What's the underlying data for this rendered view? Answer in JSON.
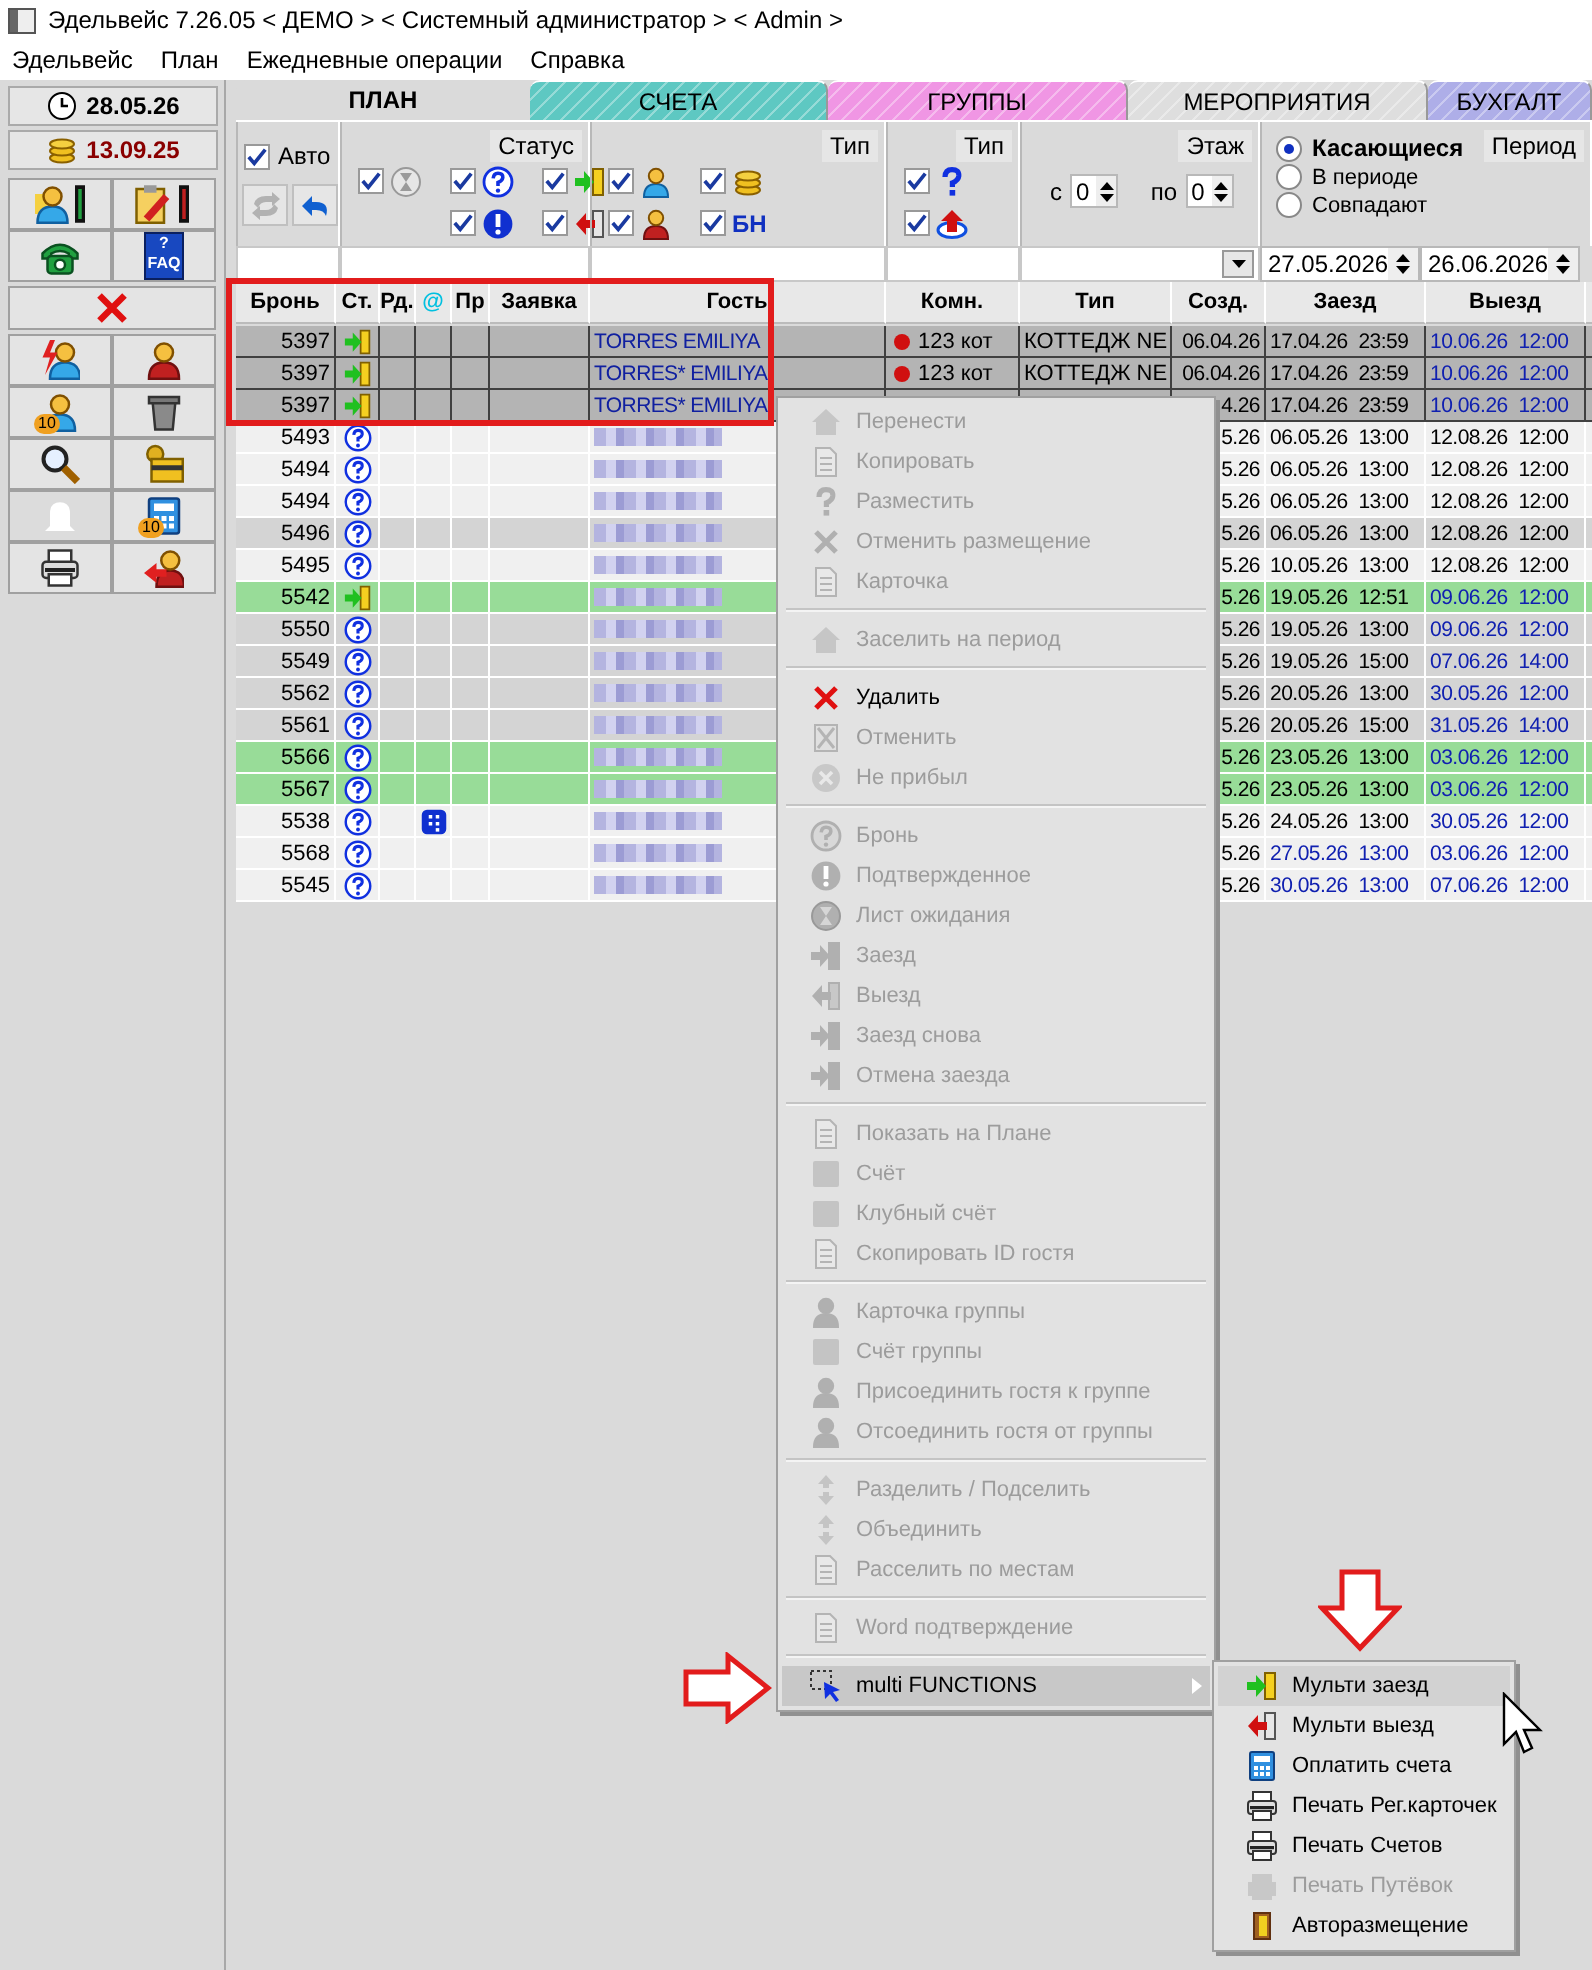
{
  "window": {
    "title": "Эдельвейс 7.26.05 < ДЕМО > < Системный администратор > < Admin >"
  },
  "menu_bar": [
    "Эдельвейс",
    "План",
    "Ежедневные операции",
    "Справка"
  ],
  "sidebar": {
    "dates": [
      "28.05.26",
      "13.09.25"
    ],
    "buttons": [
      {
        "kind": "person_meter",
        "wide": false,
        "disabled": false
      },
      {
        "kind": "clipboard_meter",
        "wide": false,
        "disabled": false
      },
      {
        "kind": "phone",
        "wide": false,
        "disabled": false
      },
      {
        "kind": "faq",
        "label": "?\nFAQ",
        "wide": false,
        "disabled": false
      },
      {
        "kind": "cross",
        "wide": true,
        "disabled": false
      },
      {
        "kind": "person_flash",
        "wide": false,
        "disabled": false
      },
      {
        "kind": "person_red",
        "wide": false,
        "disabled": false
      },
      {
        "kind": "person",
        "badge": "10",
        "wide": false,
        "disabled": false
      },
      {
        "kind": "trash",
        "wide": false,
        "disabled": false
      },
      {
        "kind": "magnifier",
        "wide": false,
        "disabled": false
      },
      {
        "kind": "keycard",
        "wide": false,
        "disabled": false
      },
      {
        "kind": "bell",
        "wide": false,
        "disabled": true
      },
      {
        "kind": "calc",
        "badge": "10",
        "wide": false,
        "disabled": false
      },
      {
        "kind": "printer",
        "wide": false,
        "disabled": false
      },
      {
        "kind": "person_arrow",
        "wide": false,
        "disabled": false
      }
    ]
  },
  "tabs": [
    {
      "label": "ПЛАН",
      "selected": true,
      "color": "#dadada"
    },
    {
      "label": "СЧЕТА",
      "selected": false,
      "color": "#5ec8c2"
    },
    {
      "label": "ГРУППЫ",
      "selected": false,
      "color": "#f096e4"
    },
    {
      "label": "МЕРОПРИЯТИЯ",
      "selected": false,
      "color": "#dedede"
    },
    {
      "label": "БУХГАЛТ",
      "selected": false,
      "color": "#aeaee8"
    }
  ],
  "filters": {
    "auto": {
      "label": "Авто",
      "checked": true
    },
    "tools": [
      {
        "kind": "refresh",
        "disabled": true
      },
      {
        "kind": "undo",
        "disabled": false
      }
    ],
    "groups": [
      {
        "label": "Статус",
        "columns": [
          [
            {
              "kind": "hourglass",
              "checked": true
            }
          ],
          [
            {
              "kind": "question",
              "checked": true
            },
            {
              "kind": "exclamation",
              "checked": true
            }
          ],
          [
            {
              "kind": "checkin",
              "checked": true
            },
            {
              "kind": "checkout",
              "checked": true
            }
          ]
        ]
      },
      {
        "label": "Тип",
        "columns": [
          [
            {
              "kind": "person",
              "checked": true
            },
            {
              "kind": "person_red",
              "checked": true
            }
          ],
          [
            {
              "kind": "coins",
              "checked": true
            },
            {
              "kind": "text",
              "text": "БН",
              "checked": true
            }
          ]
        ]
      },
      {
        "label": "Тип",
        "columns": [
          [
            {
              "kind": "question_bold",
              "checked": true
            },
            {
              "kind": "upload",
              "checked": true
            }
          ]
        ]
      }
    ],
    "floor": {
      "label": "Этаж",
      "from_label": "с",
      "from": "0",
      "to_label": "по",
      "to": "0"
    },
    "period": {
      "label": "Период",
      "options": [
        {
          "label": "Касающиеся",
          "selected": true
        },
        {
          "label": "В периоде",
          "selected": false
        },
        {
          "label": "Совпадают",
          "selected": false
        }
      ]
    },
    "date_from": "27.05.2026",
    "date_to": "26.06.2026"
  },
  "table": {
    "columns": [
      "Бронь",
      "Ст.",
      "Рд.",
      "@",
      "Пр",
      "Заявка",
      "Гость",
      "Комн.",
      "Тип",
      "Созд.",
      "Заезд",
      "Выезд"
    ],
    "rows": [
      {
        "id": "5397",
        "kind": "checkin",
        "selected": true,
        "color": "#b4b4b4",
        "web": false,
        "guest": "TORRES EMILIYA",
        "guest_blurred": false,
        "room": {
          "text": "123 кот",
          "color": "#d01010"
        },
        "type": "КОТТЕДЖ NE",
        "created": "06.04.26",
        "arrival": "17.04.26  23:59",
        "arrival_marked": false,
        "departure": "10.06.26  12:00",
        "departure_marked": true
      },
      {
        "id": "5397",
        "kind": "checkin",
        "selected": true,
        "color": "#b4b4b4",
        "web": false,
        "guest": "TORRES* EMILIYA",
        "guest_blurred": false,
        "room": {
          "text": "123 кот",
          "color": "#d01010"
        },
        "type": "КОТТЕДЖ NE",
        "created": "06.04.26",
        "arrival": "17.04.26  23:59",
        "arrival_marked": false,
        "departure": "10.06.26  12:00",
        "departure_marked": true
      },
      {
        "id": "5397",
        "kind": "checkin",
        "selected": true,
        "color": "#b4b4b4",
        "web": false,
        "guest": "TORRES* EMILIYA",
        "guest_blurred": false,
        "created": "4.26",
        "arrival": "17.04.26  23:59",
        "arrival_marked": false,
        "departure": "10.06.26  12:00",
        "departure_marked": true
      },
      {
        "id": "5493",
        "kind": "booking",
        "selected": false,
        "color": "#f0f0f0",
        "web": false,
        "guest_blurred": true,
        "created": "5.26",
        "arrival": "06.05.26  13:00",
        "arrival_marked": false,
        "departure": "12.08.26  12:00",
        "departure_marked": false
      },
      {
        "id": "5494",
        "kind": "booking",
        "selected": false,
        "color": "#f0f0f0",
        "web": false,
        "guest_blurred": true,
        "created": "5.26",
        "arrival": "06.05.26  13:00",
        "arrival_marked": false,
        "departure": "12.08.26  12:00",
        "departure_marked": false
      },
      {
        "id": "5494",
        "kind": "booking",
        "selected": false,
        "color": "#f0f0f0",
        "web": false,
        "guest_blurred": true,
        "created": "5.26",
        "arrival": "06.05.26  13:00",
        "arrival_marked": false,
        "departure": "12.08.26  12:00",
        "departure_marked": false
      },
      {
        "id": "5496",
        "kind": "booking",
        "selected": false,
        "color": "#d4d4d4",
        "web": false,
        "guest_blurred": true,
        "created": "5.26",
        "arrival": "06.05.26  13:00",
        "arrival_marked": false,
        "departure": "12.08.26  12:00",
        "departure_marked": false
      },
      {
        "id": "5495",
        "kind": "booking",
        "selected": false,
        "color": "#f0f0f0",
        "web": false,
        "guest_blurred": true,
        "created": "5.26",
        "arrival": "10.05.26  13:00",
        "arrival_marked": false,
        "departure": "12.08.26  12:00",
        "departure_marked": false
      },
      {
        "id": "5542",
        "kind": "checkin",
        "selected": false,
        "color": "#98dc98",
        "web": false,
        "guest_blurred": true,
        "created": "5.26",
        "arrival": "19.05.26  12:51",
        "arrival_marked": false,
        "departure": "09.06.26  12:00",
        "departure_marked": true
      },
      {
        "id": "5550",
        "kind": "booking",
        "selected": false,
        "color": "#d4d4d4",
        "web": false,
        "guest_blurred": true,
        "created": "5.26",
        "arrival": "19.05.26  13:00",
        "arrival_marked": false,
        "departure": "09.06.26  12:00",
        "departure_marked": true
      },
      {
        "id": "5549",
        "kind": "booking",
        "selected": false,
        "color": "#d4d4d4",
        "web": false,
        "guest_blurred": true,
        "created": "5.26",
        "arrival": "19.05.26  15:00",
        "arrival_marked": false,
        "departure": "07.06.26  14:00",
        "departure_marked": true
      },
      {
        "id": "5562",
        "kind": "booking",
        "selected": false,
        "color": "#d4d4d4",
        "web": false,
        "guest_blurred": true,
        "created": "5.26",
        "arrival": "20.05.26  13:00",
        "arrival_marked": false,
        "departure": "30.05.26  12:00",
        "departure_marked": true
      },
      {
        "id": "5561",
        "kind": "booking",
        "selected": false,
        "color": "#d4d4d4",
        "web": false,
        "guest_blurred": true,
        "created": "5.26",
        "arrival": "20.05.26  15:00",
        "arrival_marked": false,
        "departure": "31.05.26  14:00",
        "departure_marked": true
      },
      {
        "id": "5566",
        "kind": "booking",
        "selected": false,
        "color": "#98dc98",
        "web": false,
        "guest_blurred": true,
        "created": "5.26",
        "arrival": "23.05.26  13:00",
        "arrival_marked": false,
        "departure": "03.06.26  12:00",
        "departure_marked": true
      },
      {
        "id": "5567",
        "kind": "booking",
        "selected": false,
        "color": "#98dc98",
        "web": false,
        "guest_blurred": true,
        "created": "5.26",
        "arrival": "23.05.26  13:00",
        "arrival_marked": false,
        "departure": "03.06.26  12:00",
        "departure_marked": true
      },
      {
        "id": "5538",
        "kind": "booking",
        "selected": false,
        "color": "#f0f0f0",
        "web": true,
        "guest_blurred": true,
        "created": "5.26",
        "arrival": "24.05.26  13:00",
        "arrival_marked": false,
        "departure": "30.05.26  12:00",
        "departure_marked": true
      },
      {
        "id": "5568",
        "kind": "booking",
        "selected": false,
        "color": "#f0f0f0",
        "web": false,
        "guest_blurred": true,
        "created": "5.26",
        "arrival": "27.05.26  13:00",
        "arrival_marked": true,
        "departure": "03.06.26  12:00",
        "departure_marked": true
      },
      {
        "id": "5545",
        "kind": "booking",
        "selected": false,
        "color": "#f0f0f0",
        "web": false,
        "guest_blurred": true,
        "created": "5.26",
        "arrival": "30.05.26  13:00",
        "arrival_marked": true,
        "departure": "07.06.26  12:00",
        "departure_marked": true
      }
    ]
  },
  "context_menu": {
    "groups": [
      [
        {
          "label": "Перенести",
          "kind": "house",
          "disabled": true,
          "selected": false
        },
        {
          "label": "Копировать",
          "kind": "doc",
          "disabled": true,
          "selected": false
        },
        {
          "label": "Разместить",
          "kind": "question_bold",
          "disabled": true,
          "selected": false
        },
        {
          "label": "Отменить размещение",
          "kind": "cross",
          "disabled": true,
          "selected": false
        },
        {
          "label": "Карточка",
          "kind": "doc",
          "disabled": true,
          "selected": false
        }
      ],
      [
        {
          "label": "Заселить на период",
          "kind": "house",
          "disabled": true,
          "selected": false
        }
      ],
      [
        {
          "label": "Удалить",
          "kind": "cross",
          "disabled": false,
          "selected": false
        },
        {
          "label": "Отменить",
          "kind": "box",
          "disabled": true,
          "selected": false
        },
        {
          "label": "Не прибыл",
          "kind": "circle",
          "disabled": true,
          "selected": false
        }
      ],
      [
        {
          "label": "Бронь",
          "kind": "question",
          "disabled": true,
          "selected": false
        },
        {
          "label": "Подтвержденное",
          "kind": "exclamation",
          "disabled": true,
          "selected": false
        },
        {
          "label": "Лист ожидания",
          "kind": "hourglass",
          "disabled": true,
          "selected": false
        },
        {
          "label": "Заезд",
          "kind": "checkin",
          "disabled": true,
          "selected": false
        },
        {
          "label": "Выезд",
          "kind": "checkout",
          "disabled": true,
          "selected": false
        },
        {
          "label": "Заезд снова",
          "kind": "checkin",
          "disabled": true,
          "selected": false
        },
        {
          "label": "Отмена заезда",
          "kind": "checkin",
          "disabled": true,
          "selected": false
        }
      ],
      [
        {
          "label": "Показать на Плане",
          "kind": "doc",
          "disabled": true,
          "selected": false
        },
        {
          "label": "Счёт",
          "kind": "square",
          "disabled": true,
          "selected": false
        },
        {
          "label": "Клубный счёт",
          "kind": "square",
          "disabled": true,
          "selected": false
        },
        {
          "label": "Скопировать ID гостя",
          "kind": "doc",
          "disabled": true,
          "selected": false
        }
      ],
      [
        {
          "label": "Карточка группы",
          "kind": "person",
          "disabled": true,
          "selected": false
        },
        {
          "label": "Счёт группы",
          "kind": "square",
          "disabled": true,
          "selected": false
        },
        {
          "label": "Присоединить гостя к группе",
          "kind": "person",
          "disabled": true,
          "selected": false
        },
        {
          "label": "Отсоединить гостя от группы",
          "kind": "person",
          "disabled": true,
          "selected": false
        }
      ],
      [
        {
          "label": "Разделить / Подселить",
          "kind": "arrows",
          "disabled": true,
          "selected": false
        },
        {
          "label": "Объединить",
          "kind": "arrows",
          "disabled": true,
          "selected": false
        },
        {
          "label": "Расселить по местам",
          "kind": "doc",
          "disabled": true,
          "selected": false
        }
      ],
      [
        {
          "label": "Word подтверждение",
          "kind": "doc",
          "disabled": true,
          "selected": false
        }
      ],
      [
        {
          "label": "multi FUNCTIONS",
          "kind": "multi",
          "disabled": false,
          "selected": true,
          "submenu": true
        }
      ]
    ]
  },
  "submenu": {
    "items": [
      {
        "label": "Мульти заезд",
        "kind": "checkin",
        "disabled": false,
        "selected": true
      },
      {
        "label": "Мульти выезд",
        "kind": "checkout",
        "disabled": false,
        "selected": false
      },
      {
        "label": "Оплатить счета",
        "kind": "calc",
        "disabled": false,
        "selected": false
      },
      {
        "label": "Печать Рег.карточек",
        "kind": "printer",
        "disabled": false,
        "selected": false
      },
      {
        "label": "Печать Счетов",
        "kind": "printer",
        "disabled": false,
        "selected": false
      },
      {
        "label": "Печать Путёвок",
        "kind": "printer",
        "disabled": true,
        "selected": false
      },
      {
        "label": "Авторазмещение",
        "kind": "door",
        "disabled": false,
        "selected": false
      }
    ]
  },
  "annotations": [
    {
      "kind": "frame"
    },
    {
      "kind": "arrow_right"
    },
    {
      "kind": "arrow_down"
    },
    {
      "kind": "cursor"
    }
  ]
}
